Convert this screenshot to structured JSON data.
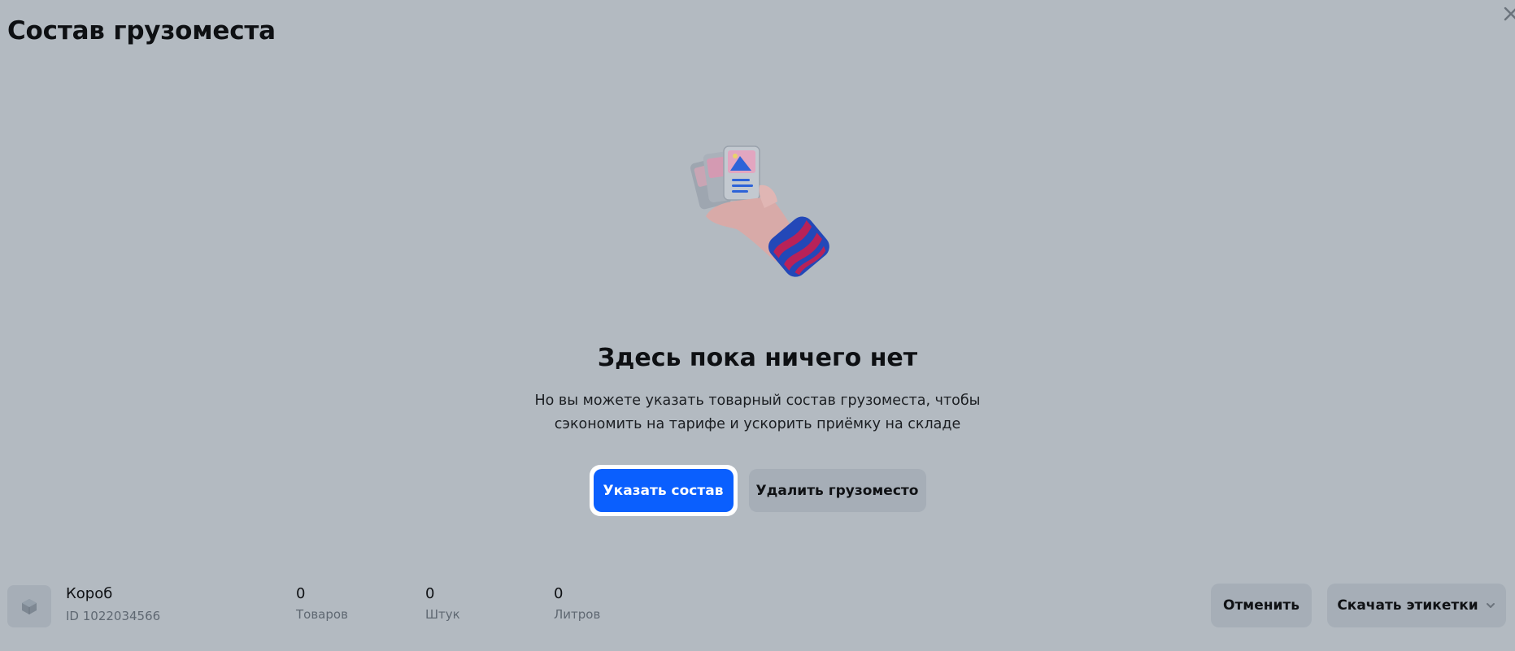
{
  "header": {
    "title": "Состав грузоместа"
  },
  "empty_state": {
    "title": "Здесь пока ничего нет",
    "description": "Но вы можете указать товарный состав грузоместа, чтобы сэкономить на тарифе и ускорить приёмку на складе",
    "illustration_icon": "hand-holding-cards-icon"
  },
  "actions": {
    "specify_label": "Указать состав",
    "delete_label": "Удалить грузоместо"
  },
  "footer": {
    "box_icon": "box-icon",
    "box_name": "Короб",
    "box_id": "ID 1022034566",
    "stats": [
      {
        "value": "0",
        "label": "Товаров"
      },
      {
        "value": "0",
        "label": "Штук"
      },
      {
        "value": "0",
        "label": "Литров"
      }
    ],
    "cancel_label": "Отменить",
    "download_label": "Скачать этикетки"
  },
  "colors": {
    "background": "#b3bac1",
    "primary": "#0a5ffe",
    "secondary_button": "#a6aeb7",
    "focus_ring": "#ffffff"
  }
}
